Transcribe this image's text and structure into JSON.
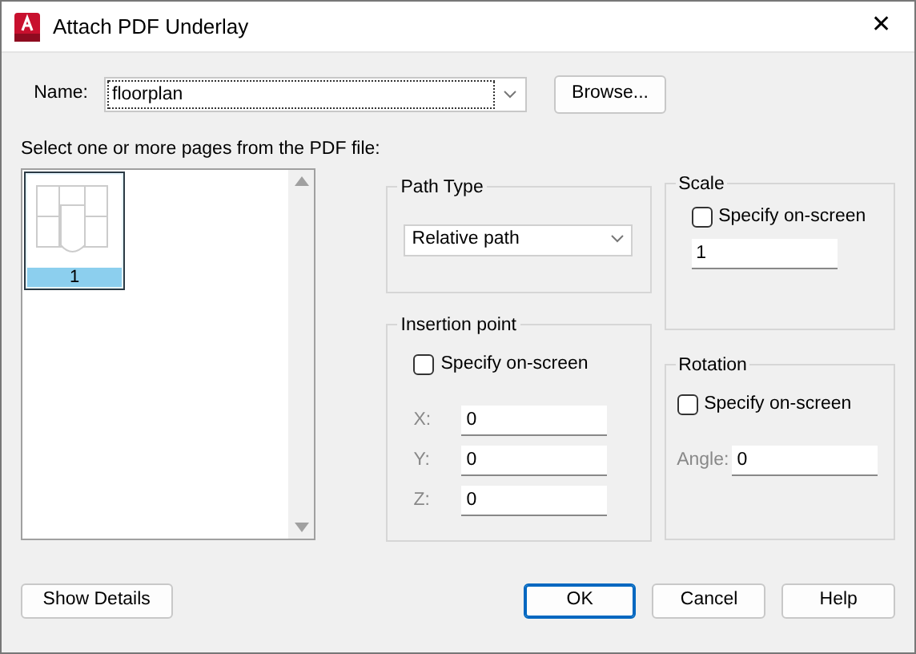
{
  "window": {
    "title": "Attach PDF Underlay",
    "close": "✕"
  },
  "name_field": {
    "label": "Name:",
    "value": "floorplan"
  },
  "browse_button": "Browse...",
  "pages_label": "Select one or more pages from the PDF file:",
  "pages": [
    {
      "label": "1",
      "selected": true
    }
  ],
  "path_type": {
    "title": "Path Type",
    "value": "Relative path"
  },
  "insertion_point": {
    "title": "Insertion point",
    "specify_on_screen": {
      "label": "Specify on-screen",
      "checked": false
    },
    "fields": [
      {
        "label": "X:",
        "value": "0"
      },
      {
        "label": "Y:",
        "value": "0"
      },
      {
        "label": "Z:",
        "value": "0"
      }
    ]
  },
  "scale": {
    "title": "Scale",
    "specify_on_screen": {
      "label": "Specify on-screen",
      "checked": false
    },
    "value": "1"
  },
  "rotation": {
    "title": "Rotation",
    "specify_on_screen": {
      "label": "Specify on-screen",
      "checked": false
    },
    "angle_label": "Angle:",
    "angle": "0"
  },
  "buttons": [
    {
      "label": "Show Details",
      "kind": "left"
    },
    {
      "label": "OK",
      "kind": "default"
    },
    {
      "label": "Cancel",
      "kind": "normal"
    },
    {
      "label": "Help",
      "kind": "normal"
    }
  ]
}
